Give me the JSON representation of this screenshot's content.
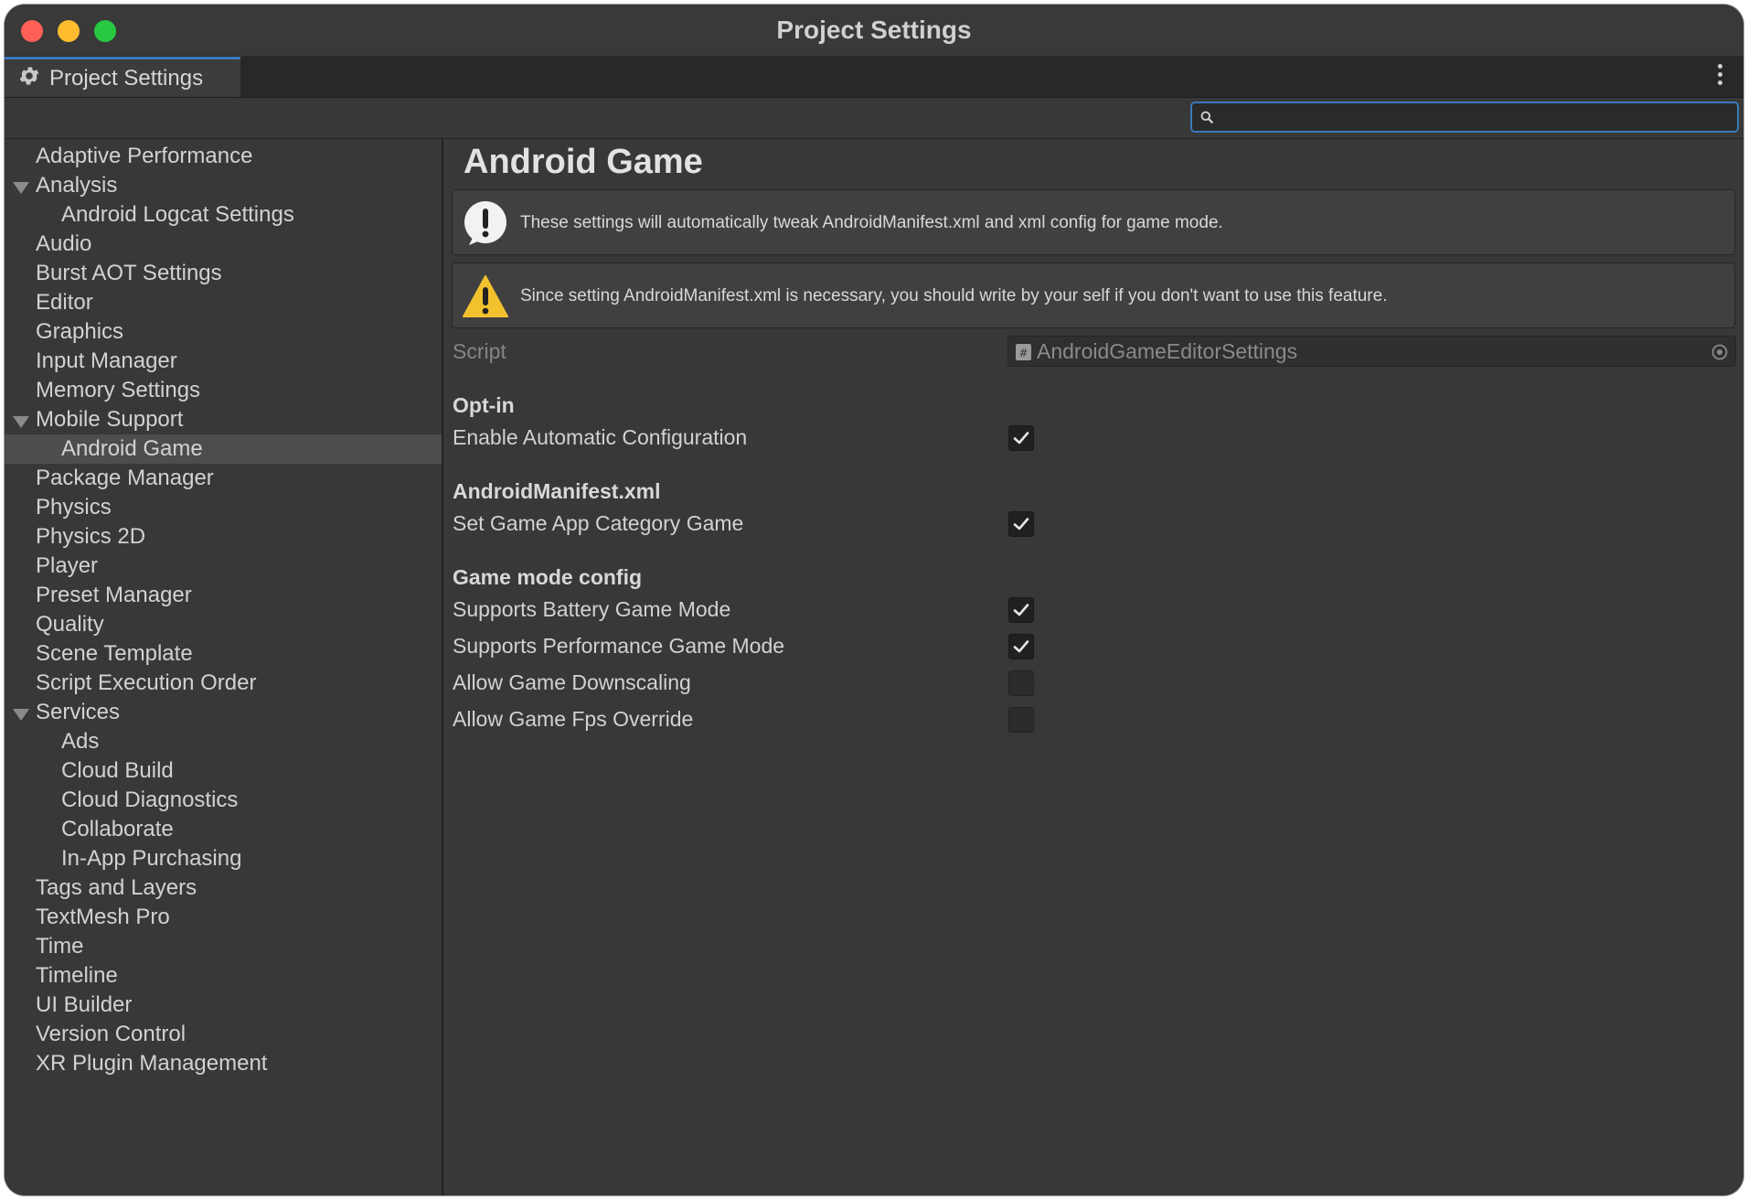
{
  "window": {
    "title": "Project Settings"
  },
  "tab": {
    "label": "Project Settings"
  },
  "search": {
    "placeholder": "",
    "value": ""
  },
  "sidebar": {
    "items": [
      {
        "label": "Adaptive Performance",
        "level": 0,
        "expandable": false
      },
      {
        "label": "Analysis",
        "level": 0,
        "expandable": true
      },
      {
        "label": "Android Logcat Settings",
        "level": 1,
        "expandable": false
      },
      {
        "label": "Audio",
        "level": 0,
        "expandable": false
      },
      {
        "label": "Burst AOT Settings",
        "level": 0,
        "expandable": false
      },
      {
        "label": "Editor",
        "level": 0,
        "expandable": false
      },
      {
        "label": "Graphics",
        "level": 0,
        "expandable": false
      },
      {
        "label": "Input Manager",
        "level": 0,
        "expandable": false
      },
      {
        "label": "Memory Settings",
        "level": 0,
        "expandable": false
      },
      {
        "label": "Mobile Support",
        "level": 0,
        "expandable": true
      },
      {
        "label": "Android Game",
        "level": 1,
        "expandable": false,
        "selected": true
      },
      {
        "label": "Package Manager",
        "level": 0,
        "expandable": false
      },
      {
        "label": "Physics",
        "level": 0,
        "expandable": false
      },
      {
        "label": "Physics 2D",
        "level": 0,
        "expandable": false
      },
      {
        "label": "Player",
        "level": 0,
        "expandable": false
      },
      {
        "label": "Preset Manager",
        "level": 0,
        "expandable": false
      },
      {
        "label": "Quality",
        "level": 0,
        "expandable": false
      },
      {
        "label": "Scene Template",
        "level": 0,
        "expandable": false
      },
      {
        "label": "Script Execution Order",
        "level": 0,
        "expandable": false
      },
      {
        "label": "Services",
        "level": 0,
        "expandable": true
      },
      {
        "label": "Ads",
        "level": 1,
        "expandable": false
      },
      {
        "label": "Cloud Build",
        "level": 1,
        "expandable": false
      },
      {
        "label": "Cloud Diagnostics",
        "level": 1,
        "expandable": false
      },
      {
        "label": "Collaborate",
        "level": 1,
        "expandable": false
      },
      {
        "label": "In-App Purchasing",
        "level": 1,
        "expandable": false
      },
      {
        "label": "Tags and Layers",
        "level": 0,
        "expandable": false
      },
      {
        "label": "TextMesh Pro",
        "level": 0,
        "expandable": false
      },
      {
        "label": "Time",
        "level": 0,
        "expandable": false
      },
      {
        "label": "Timeline",
        "level": 0,
        "expandable": false
      },
      {
        "label": "UI Builder",
        "level": 0,
        "expandable": false
      },
      {
        "label": "Version Control",
        "level": 0,
        "expandable": false
      },
      {
        "label": "XR Plugin Management",
        "level": 0,
        "expandable": false
      }
    ]
  },
  "content": {
    "title": "Android Game",
    "info_message": "These settings will automatically tweak AndroidManifest.xml and xml config for game mode.",
    "warning_message": "Since setting AndroidManifest.xml is necessary, you should write by your self if you don't want to use this feature.",
    "script": {
      "label": "Script",
      "value": "AndroidGameEditorSettings"
    },
    "sections": {
      "opt_in": {
        "header": "Opt-in",
        "enable_auto_config": {
          "label": "Enable Automatic Configuration",
          "checked": true
        }
      },
      "manifest": {
        "header": "AndroidManifest.xml",
        "set_game_category": {
          "label": "Set Game App Category Game",
          "checked": true
        }
      },
      "game_mode": {
        "header": "Game mode config",
        "battery": {
          "label": "Supports Battery Game Mode",
          "checked": true
        },
        "performance": {
          "label": "Supports Performance Game Mode",
          "checked": true
        },
        "downscaling": {
          "label": "Allow Game Downscaling",
          "checked": false
        },
        "fps_override": {
          "label": "Allow Game Fps Override",
          "checked": false
        }
      }
    }
  },
  "colors": {
    "background": "#383838",
    "selection": "#4d4d4d",
    "accent_blue": "#3a79bb",
    "warning_yellow": "#f2c12e",
    "text": "#d2d2d2"
  }
}
